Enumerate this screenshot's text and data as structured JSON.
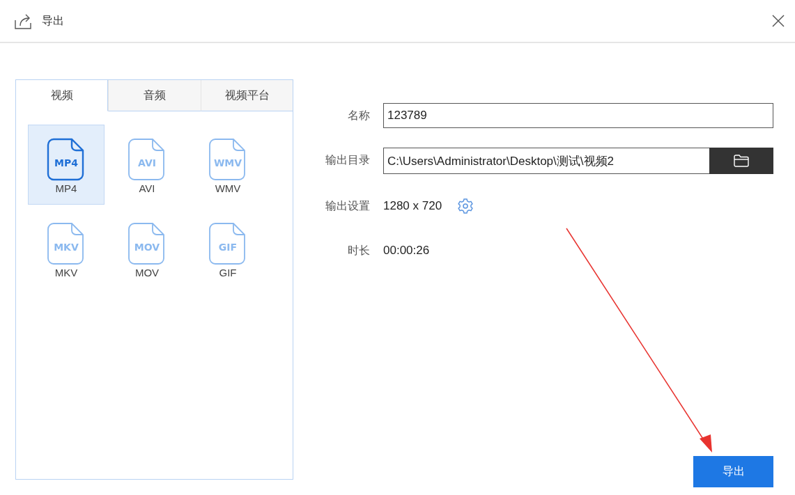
{
  "window": {
    "title": "导出"
  },
  "tabs": [
    {
      "label": "视频",
      "selected": true
    },
    {
      "label": "音频",
      "selected": false
    },
    {
      "label": "视频平台",
      "selected": false
    }
  ],
  "formats": [
    {
      "icon_text": "MP4",
      "label": "MP4",
      "selected": true
    },
    {
      "icon_text": "AVI",
      "label": "AVI",
      "selected": false
    },
    {
      "icon_text": "WMV",
      "label": "WMV",
      "selected": false
    },
    {
      "icon_text": "MKV",
      "label": "MKV",
      "selected": false
    },
    {
      "icon_text": "MOV",
      "label": "MOV",
      "selected": false
    },
    {
      "icon_text": "GIF",
      "label": "GIF",
      "selected": false
    }
  ],
  "form": {
    "name_label": "名称",
    "name_value": "123789",
    "dir_label": "输出目录",
    "dir_value": "C:\\Users\\Administrator\\Desktop\\测试\\视频2",
    "settings_label": "输出设置",
    "settings_value": "1280 x 720",
    "duration_label": "时长",
    "duration_value": "00:00:26"
  },
  "export_button": "导出"
}
